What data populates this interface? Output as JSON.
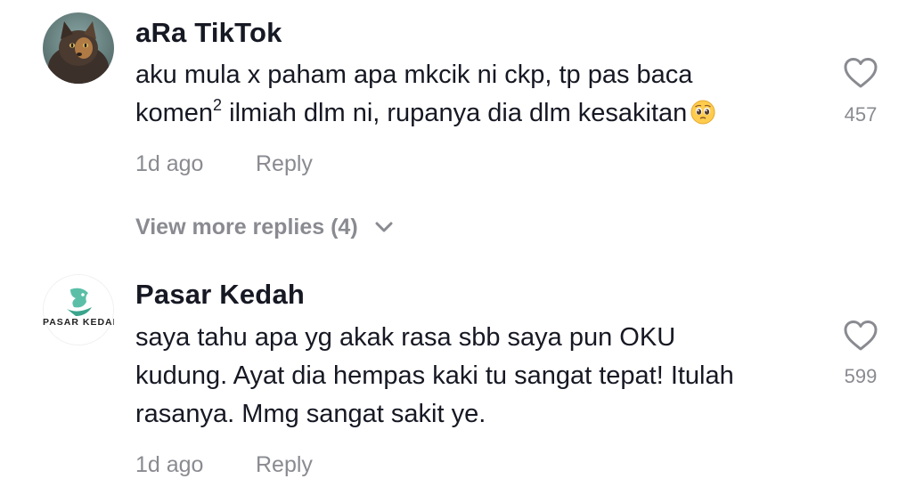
{
  "comments": [
    {
      "username": "aRa TikTok",
      "avatar_icon": "cat-photo-avatar",
      "text_lines": [
        "aku mula x paham apa mkcik ni ckp, tp pas baca",
        "komen",
        "ilmiah dlm ni, rupanya dia dlm kesakitan"
      ],
      "superscript": "2",
      "emoji": "pleading-face-emoji",
      "time": "1d ago",
      "reply_label": "Reply",
      "like_icon": "heart-outline-icon",
      "likes": "457"
    },
    {
      "username": "Pasar Kedah",
      "avatar_icon": "pasar-kedah-logo-avatar",
      "avatar_text": "PASAR KEDAH",
      "text_lines": [
        "saya tahu apa yg akak rasa sbb saya pun OKU",
        "kudung. Ayat dia hempas kaki tu sangat tepat! Itulah",
        "rasanya. Mmg sangat sakit ye."
      ],
      "time": "1d ago",
      "reply_label": "Reply",
      "like_icon": "heart-outline-icon",
      "likes": "599"
    }
  ],
  "view_more": {
    "label": "View more replies (4)",
    "icon": "chevron-down-icon"
  },
  "colors": {
    "text_primary": "#161823",
    "text_secondary": "#8a8b91",
    "logo_green": "#5bbfa8"
  }
}
